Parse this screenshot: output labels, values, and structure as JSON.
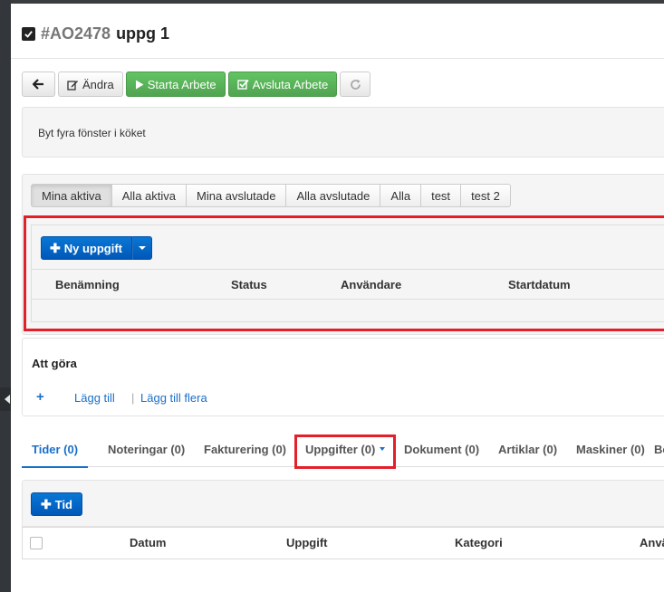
{
  "header": {
    "order_id": "#AO2478",
    "title": "uppg 1"
  },
  "toolbar": {
    "back_label": "",
    "edit_label": "Ändra",
    "start_label": "Starta Arbete",
    "finish_label": "Avsluta Arbete"
  },
  "description": "Byt fyra fönster i köket",
  "filter_tabs": [
    "Mina aktiva",
    "Alla aktiva",
    "Mina avslutade",
    "Alla avslutade",
    "Alla",
    "test",
    "test 2"
  ],
  "task_panel": {
    "new_task_label": "Ny uppgift",
    "columns": [
      "Benämning",
      "Status",
      "Användare",
      "Startdatum"
    ]
  },
  "todo": {
    "title": "Att göra",
    "plus": "+",
    "add_label": "Lägg till",
    "separator": "|",
    "add_many_label": "Lägg till flera"
  },
  "bottom_tabs": [
    "Tider (0)",
    "Noteringar (0)",
    "Fakturering (0)",
    "Uppgifter (0)",
    "Dokument (0)",
    "Artiklar (0)",
    "Maskiner (0)",
    "Be"
  ],
  "time_panel": {
    "add_label": "Tid",
    "columns": [
      "Datum",
      "Uppgift",
      "Kategori",
      "Anvä"
    ]
  },
  "colors": {
    "primary": "#0a6fd0",
    "success": "#5bb75b",
    "highlight": "#e3202a",
    "link": "#1a6fc9"
  }
}
